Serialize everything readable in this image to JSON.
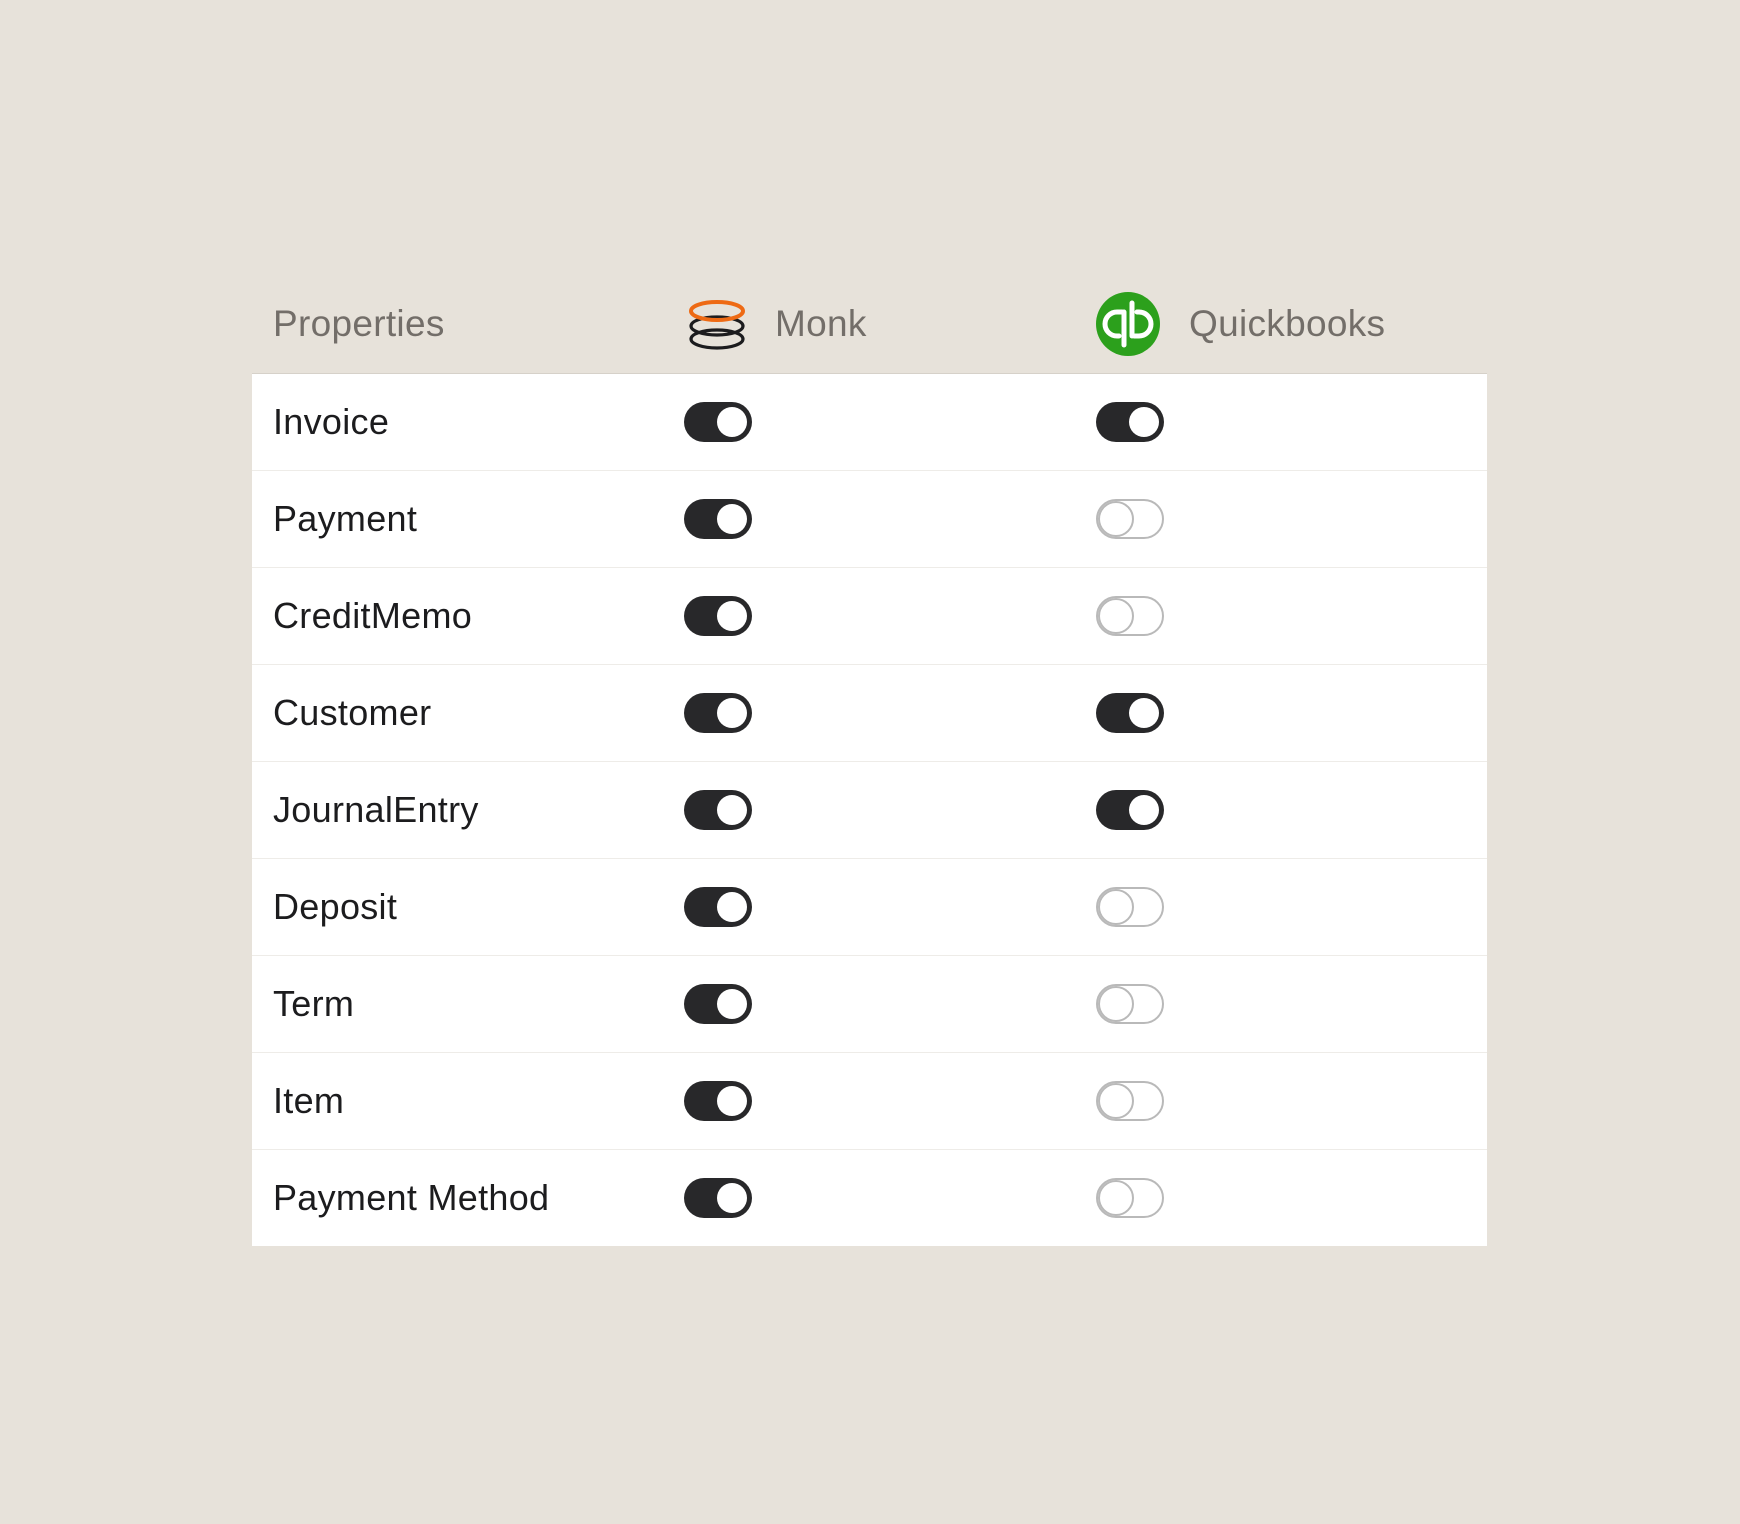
{
  "table": {
    "columns": [
      {
        "label": "Properties",
        "icon": null
      },
      {
        "label": "Monk",
        "icon": "monk-stacked-rings-logo-icon"
      },
      {
        "label": "Quickbooks",
        "icon": "quickbooks-qb-logo-icon"
      }
    ],
    "rows": [
      {
        "label": "Invoice",
        "monk": true,
        "quickbooks": true
      },
      {
        "label": "Payment",
        "monk": true,
        "quickbooks": false
      },
      {
        "label": "CreditMemo",
        "monk": true,
        "quickbooks": false
      },
      {
        "label": "Customer",
        "monk": true,
        "quickbooks": true
      },
      {
        "label": "JournalEntry",
        "monk": true,
        "quickbooks": true
      },
      {
        "label": "Deposit",
        "monk": true,
        "quickbooks": false
      },
      {
        "label": "Term",
        "monk": true,
        "quickbooks": false
      },
      {
        "label": "Item",
        "monk": true,
        "quickbooks": false
      },
      {
        "label": "Payment Method",
        "monk": true,
        "quickbooks": false
      }
    ]
  },
  "colors": {
    "page_background": "#e7e2da",
    "table_background": "#ffffff",
    "toggle_on": "#28282a",
    "toggle_off_border": "#b9b9b9",
    "monk_accent": "#ee6a14",
    "quickbooks_green": "#2ca01c"
  }
}
